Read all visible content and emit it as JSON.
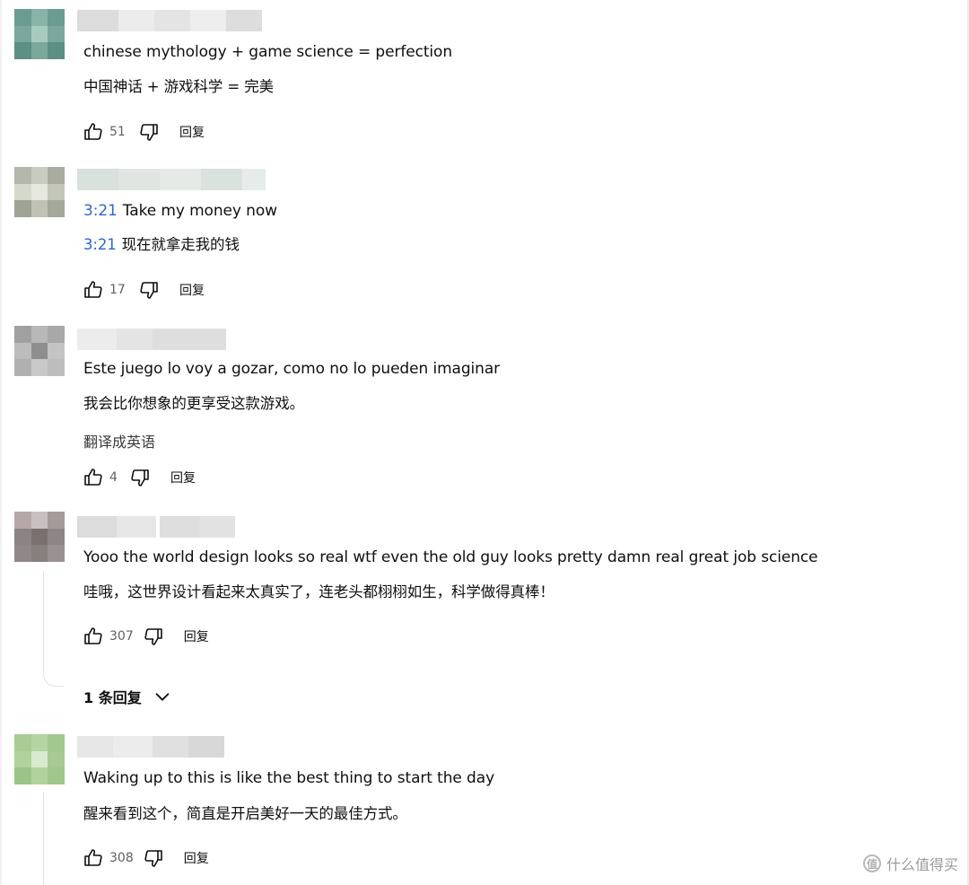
{
  "comments": [
    {
      "text_en": "chinese mythology + game science = perfection",
      "text_zh": "中国神话 + 游戏科学 = 完美",
      "likes": "51",
      "reply_label": "回复"
    },
    {
      "timestamp_en": "3:21",
      "text_en": "Take my money now",
      "timestamp_zh": "3:21",
      "text_zh": "现在就拿走我的钱",
      "likes": "17",
      "reply_label": "回复"
    },
    {
      "text_en": "Este juego lo voy a gozar, como no lo pueden imaginar",
      "text_zh": "我会比你想象的更享受这款游戏。",
      "translate_label": "翻译成英语",
      "likes": "4",
      "reply_label": "回复"
    },
    {
      "text_en": "Yooo the world design looks so real wtf even the old guy looks pretty damn real great job science",
      "text_zh": "哇哦，这世界设计看起来太真实了，连老头都栩栩如生，科学做得真棒！",
      "likes": "307",
      "reply_label": "回复",
      "replies_toggle": "1 条回复"
    },
    {
      "text_en": "Waking up to this is like the best thing to start the day",
      "text_zh": "醒来看到这个，简直是开启美好一天的最佳方式。",
      "likes": "308",
      "reply_label": "回复"
    }
  ],
  "watermark": {
    "logo_char": "值",
    "text": "什么值得买"
  },
  "colors": {
    "timestamp_link": "#2a66d1",
    "secondary_text": "#606060"
  },
  "icons": [
    "thumbs-up-icon",
    "thumbs-down-icon",
    "chevron-down-icon"
  ]
}
